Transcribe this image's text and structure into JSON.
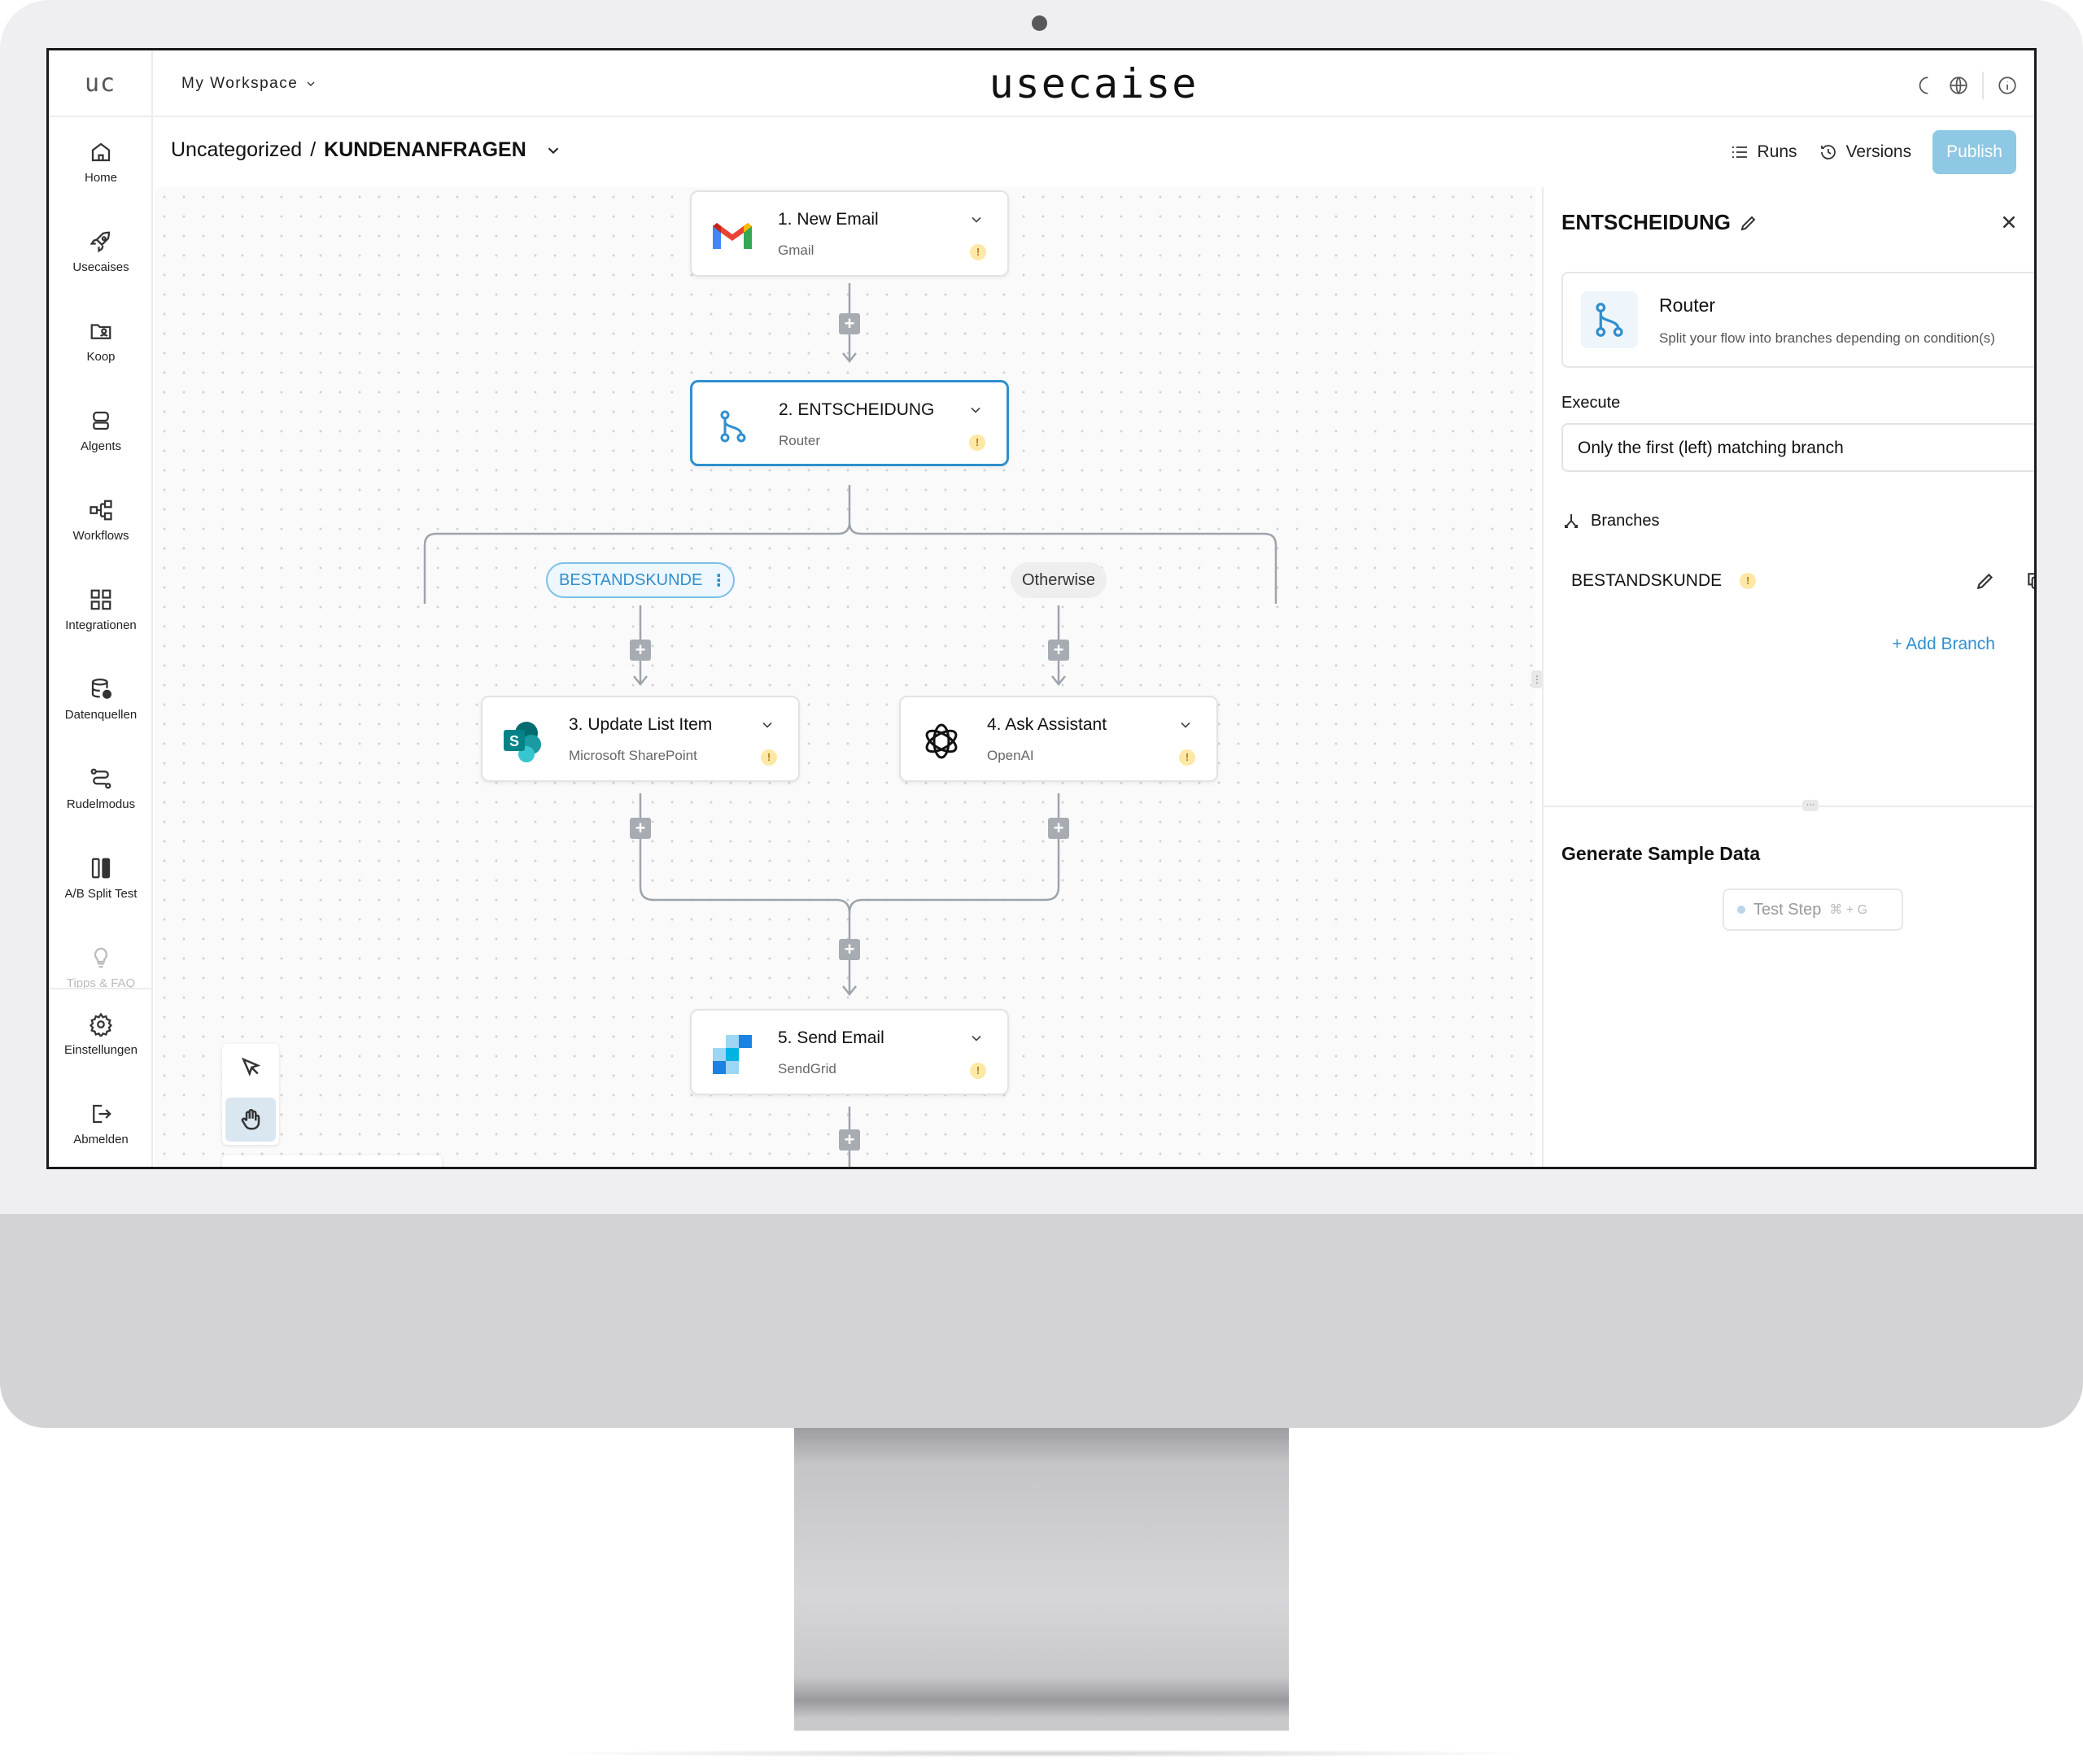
{
  "workspace": {
    "label": "My Workspace"
  },
  "brand": {
    "logo": "uc",
    "name": "usecaise"
  },
  "sidebar": {
    "items": [
      {
        "label": "Home",
        "icon": "home-icon"
      },
      {
        "label": "Usecaises",
        "icon": "rocket-icon"
      },
      {
        "label": "Koop",
        "icon": "folder-user-icon"
      },
      {
        "label": "Algents",
        "icon": "bot-icon"
      },
      {
        "label": "Workflows",
        "icon": "workflow-icon"
      },
      {
        "label": "Integrationen",
        "icon": "grid-icon"
      },
      {
        "label": "Datenquellen",
        "icon": "database-icon"
      },
      {
        "label": "Rudelmodus",
        "icon": "route-icon"
      },
      {
        "label": "A/B Split Test",
        "icon": "split-icon"
      },
      {
        "label": "Tipps & FAQ",
        "icon": "bulb-icon"
      },
      {
        "label": "Einstellungen",
        "icon": "gear-icon"
      },
      {
        "label": "Abmelden",
        "icon": "logout-icon"
      }
    ]
  },
  "breadcrumb": {
    "parent": "Uncategorized",
    "separator": "/",
    "current": "KUNDENANFRAGEN"
  },
  "toolbar": {
    "runs": "Runs",
    "versions": "Versions",
    "publish": "Publish"
  },
  "flow": {
    "nodes": [
      {
        "title": "1. New Email",
        "subtitle": "Gmail",
        "warn": "!"
      },
      {
        "title": "2. ENTSCHEIDUNG",
        "subtitle": "Router",
        "warn": "!"
      },
      {
        "title": "3. Update List Item",
        "subtitle": "Microsoft SharePoint",
        "warn": "!"
      },
      {
        "title": "4. Ask Assistant",
        "subtitle": "OpenAI",
        "warn": "!"
      },
      {
        "title": "5. Send Email",
        "subtitle": "SendGrid",
        "warn": "!"
      }
    ],
    "branches": {
      "left": "BESTANDSKUNDE",
      "right": "Otherwise"
    },
    "plus": "+"
  },
  "panel": {
    "title": "ENTSCHEIDUNG",
    "router_title": "Router",
    "router_desc": "Split your flow into branches depending on condition(s)",
    "execute_label": "Execute",
    "execute_value": "Only the first (left) matching branch",
    "branches_label": "Branches",
    "branch_name": "BESTANDSKUNDE",
    "branch_warn": "!",
    "add_branch": "+ Add Branch",
    "sample_title": "Generate Sample Data",
    "test_step": "Test Step",
    "test_shortcut": "⌘ + G"
  },
  "colors": {
    "accent": "#2f8fd0",
    "publish": "#8ec8e4",
    "warning": "#fde8a6"
  }
}
